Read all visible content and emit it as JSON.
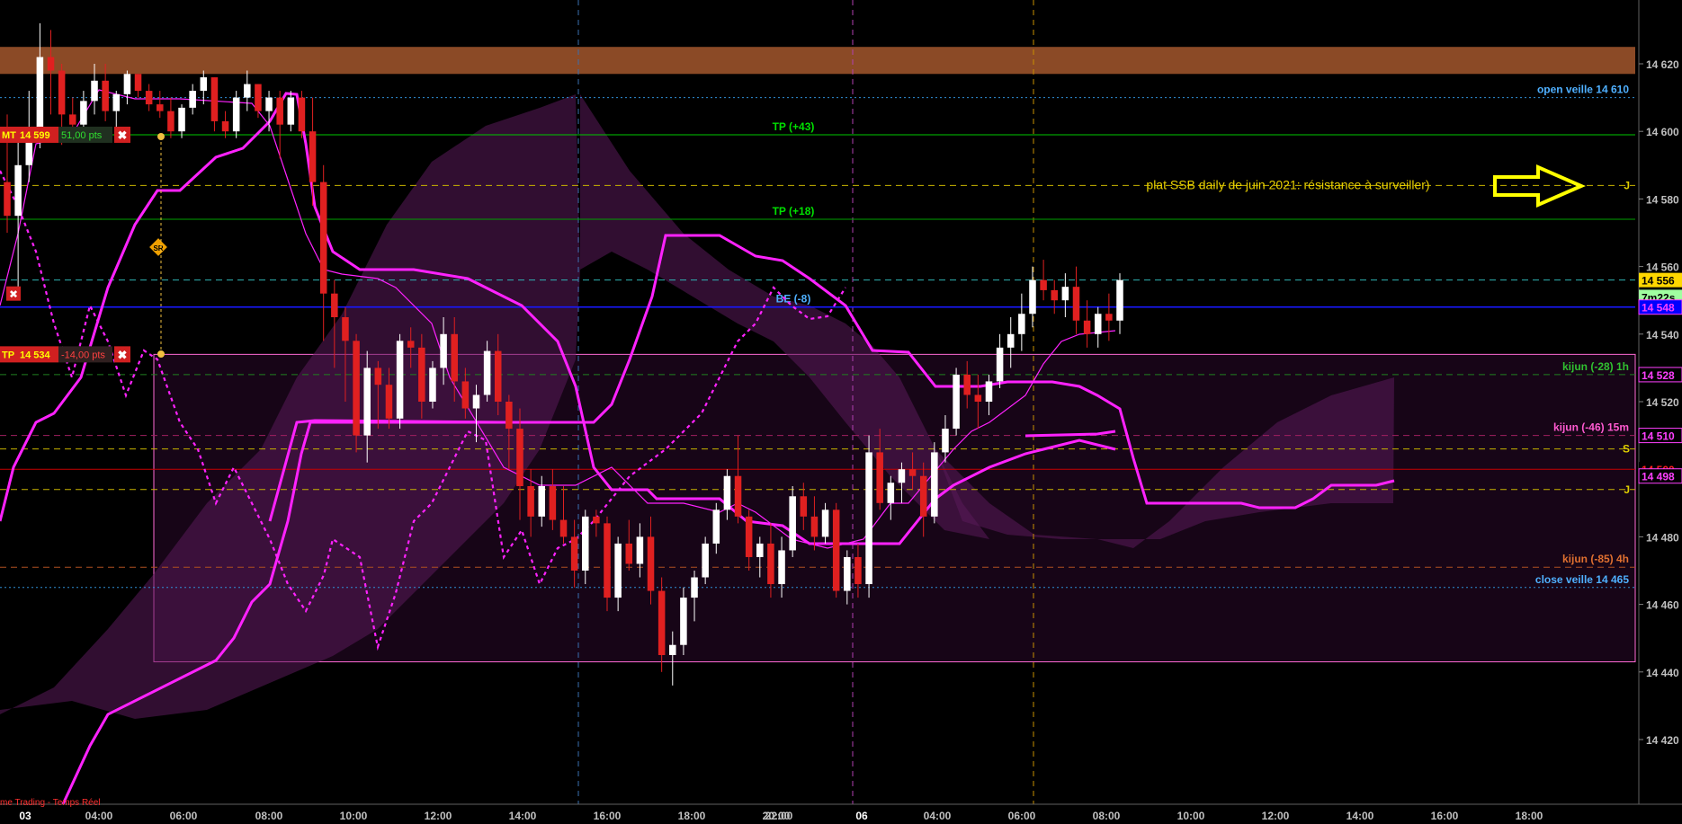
{
  "chart_data": {
    "type": "candlestick",
    "title": "",
    "footer": "me Trading - Temps Réel",
    "yaxis": {
      "ylim": [
        14408,
        14633
      ],
      "ticks": [
        "14 620",
        "14 600",
        "14 580",
        "14 560",
        "14 540",
        "14 520",
        "14 500",
        "14 480",
        "14 460",
        "14 440",
        "14 420"
      ]
    },
    "xaxis": {
      "labels": [
        "03",
        "04:00",
        "06:00",
        "08:00",
        "10:00",
        "12:00",
        "14:00",
        "16:00",
        "18:00",
        "20:00",
        "22:00",
        "06",
        "04:00",
        "06:00",
        "08:00",
        "10:00",
        "12:00",
        "14:00",
        "16:00",
        "18:00"
      ],
      "bold_labels": [
        "03",
        "06"
      ]
    },
    "candles_ohlc": [
      [
        14585,
        14605,
        14570,
        14575
      ],
      [
        14575,
        14598,
        14550,
        14590
      ],
      [
        14590,
        14612,
        14585,
        14598
      ],
      [
        14598,
        14632,
        14595,
        14622
      ],
      [
        14622,
        14630,
        14605,
        14618
      ],
      [
        14618,
        14620,
        14596,
        14605
      ],
      [
        14605,
        14610,
        14598,
        14602
      ],
      [
        14602,
        14612,
        14600,
        14609
      ],
      [
        14609,
        14620,
        14605,
        14615
      ],
      [
        14615,
        14620,
        14603,
        14606
      ],
      [
        14606,
        14612,
        14600,
        14611
      ],
      [
        14611,
        14618,
        14608,
        14617
      ],
      [
        14617,
        14617,
        14610,
        14612
      ],
      [
        14612,
        14614,
        14606,
        14608
      ],
      [
        14608,
        14612,
        14604,
        14606
      ],
      [
        14606,
        14610,
        14598,
        14600
      ],
      [
        14600,
        14608,
        14598,
        14607
      ],
      [
        14607,
        14614,
        14605,
        14612
      ],
      [
        14612,
        14618,
        14608,
        14616
      ],
      [
        14616,
        14616,
        14600,
        14603
      ],
      [
        14603,
        14606,
        14598,
        14600
      ],
      [
        14600,
        14612,
        14598,
        14610
      ],
      [
        14610,
        14618,
        14606,
        14614
      ],
      [
        14614,
        14614,
        14604,
        14606
      ],
      [
        14606,
        14612,
        14600,
        14610
      ],
      [
        14610,
        14612,
        14592,
        14602
      ],
      [
        14602,
        14612,
        14600,
        14610
      ],
      [
        14610,
        14612,
        14598,
        14600
      ],
      [
        14600,
        14610,
        14578,
        14585
      ],
      [
        14585,
        14590,
        14538,
        14552
      ],
      [
        14552,
        14556,
        14530,
        14545
      ],
      [
        14545,
        14548,
        14520,
        14538
      ],
      [
        14538,
        14540,
        14505,
        14510
      ],
      [
        14510,
        14535,
        14502,
        14530
      ],
      [
        14530,
        14532,
        14512,
        14525
      ],
      [
        14525,
        14530,
        14512,
        14515
      ],
      [
        14515,
        14540,
        14512,
        14538
      ],
      [
        14538,
        14542,
        14530,
        14536
      ],
      [
        14536,
        14540,
        14515,
        14520
      ],
      [
        14520,
        14532,
        14518,
        14530
      ],
      [
        14530,
        14545,
        14525,
        14540
      ],
      [
        14540,
        14545,
        14520,
        14526
      ],
      [
        14526,
        14530,
        14515,
        14518
      ],
      [
        14518,
        14525,
        14508,
        14522
      ],
      [
        14522,
        14538,
        14520,
        14535
      ],
      [
        14535,
        14540,
        14516,
        14520
      ],
      [
        14520,
        14522,
        14500,
        14512
      ],
      [
        14512,
        14518,
        14485,
        14495
      ],
      [
        14495,
        14500,
        14480,
        14486
      ],
      [
        14486,
        14498,
        14483,
        14495
      ],
      [
        14495,
        14500,
        14482,
        14485
      ],
      [
        14485,
        14495,
        14478,
        14480
      ],
      [
        14480,
        14485,
        14465,
        14470
      ],
      [
        14470,
        14488,
        14466,
        14486
      ],
      [
        14486,
        14488,
        14480,
        14484
      ],
      [
        14484,
        14486,
        14458,
        14462
      ],
      [
        14462,
        14480,
        14458,
        14478
      ],
      [
        14478,
        14485,
        14470,
        14472
      ],
      [
        14472,
        14484,
        14468,
        14480
      ],
      [
        14480,
        14486,
        14460,
        14464
      ],
      [
        14464,
        14468,
        14440,
        14445
      ],
      [
        14445,
        14452,
        14436,
        14448
      ],
      [
        14448,
        14465,
        14445,
        14462
      ],
      [
        14462,
        14470,
        14455,
        14468
      ],
      [
        14468,
        14480,
        14466,
        14478
      ],
      [
        14478,
        14490,
        14475,
        14488
      ],
      [
        14488,
        14500,
        14485,
        14498
      ],
      [
        14498,
        14510,
        14484,
        14486
      ],
      [
        14486,
        14488,
        14470,
        14474
      ],
      [
        14474,
        14480,
        14468,
        14478
      ],
      [
        14478,
        14484,
        14462,
        14466
      ],
      [
        14466,
        14480,
        14462,
        14476
      ],
      [
        14476,
        14495,
        14474,
        14492
      ],
      [
        14492,
        14496,
        14482,
        14486
      ],
      [
        14486,
        14492,
        14476,
        14480
      ],
      [
        14480,
        14490,
        14478,
        14488
      ],
      [
        14488,
        14490,
        14462,
        14464
      ],
      [
        14464,
        14476,
        14460,
        14474
      ],
      [
        14474,
        14478,
        14462,
        14466
      ],
      [
        14466,
        14510,
        14462,
        14505
      ],
      [
        14505,
        14512,
        14488,
        14490
      ],
      [
        14490,
        14498,
        14485,
        14496
      ],
      [
        14496,
        14502,
        14490,
        14500
      ],
      [
        14500,
        14505,
        14494,
        14498
      ],
      [
        14498,
        14502,
        14480,
        14486
      ],
      [
        14486,
        14508,
        14484,
        14505
      ],
      [
        14505,
        14516,
        14502,
        14512
      ],
      [
        14512,
        14530,
        14510,
        14528
      ],
      [
        14528,
        14532,
        14518,
        14522
      ],
      [
        14522,
        14528,
        14512,
        14520
      ],
      [
        14520,
        14528,
        14516,
        14526
      ],
      [
        14526,
        14540,
        14524,
        14536
      ],
      [
        14536,
        14545,
        14530,
        14540
      ],
      [
        14540,
        14552,
        14535,
        14546
      ],
      [
        14546,
        14560,
        14542,
        14556
      ],
      [
        14556,
        14562,
        14550,
        14553
      ],
      [
        14553,
        14556,
        14546,
        14550
      ],
      [
        14550,
        14558,
        14545,
        14554
      ],
      [
        14554,
        14560,
        14540,
        14544
      ],
      [
        14544,
        14550,
        14536,
        14540
      ],
      [
        14540,
        14548,
        14536,
        14546
      ],
      [
        14546,
        14552,
        14538,
        14544
      ],
      [
        14544,
        14558,
        14540,
        14556
      ]
    ],
    "levels": [
      {
        "label": "open veille 14 610",
        "value": 14610,
        "color": "#2f8fd6",
        "style": "dotted"
      },
      {
        "label": "TP (+43)",
        "value": 14599,
        "color": "#00c800",
        "style": "solid"
      },
      {
        "label": "plat SSB daily de juin 2021: résistance à surveiller)",
        "value": 14584,
        "color": "#c8b400",
        "style": "dashed",
        "tag": "J"
      },
      {
        "label": "TP (+18)",
        "value": 14574,
        "color": "#00a000",
        "style": "solid"
      },
      {
        "label": "",
        "value": 14556,
        "color": "#2fb4b4",
        "style": "dashed"
      },
      {
        "label": "BE (-8)",
        "value": 14548,
        "color": "#b4b4b4",
        "style": "solid"
      },
      {
        "label": "",
        "value": 14548,
        "color": "#1818ff",
        "style": "solid"
      },
      {
        "label": "kijun (-28) 1h",
        "value": 14528,
        "color": "#208020",
        "style": "dashed"
      },
      {
        "label": "kijun (-46) 15m",
        "value": 14510,
        "color": "#a02060",
        "style": "dashed"
      },
      {
        "label": "",
        "value": 14506,
        "color": "#c8b400",
        "style": "dashed",
        "tag": "S"
      },
      {
        "label": "",
        "value": 14500,
        "color": "#c80000",
        "style": "solid"
      },
      {
        "label": "",
        "value": 14494,
        "color": "#c8b400",
        "style": "dashed",
        "tag": "J"
      },
      {
        "label": "kijun (-85) 4h",
        "value": 14471,
        "color": "#b05020",
        "style": "dashed"
      },
      {
        "label": "close veille 14 465",
        "value": 14465,
        "color": "#2f8fd6",
        "style": "dotted"
      }
    ],
    "resistance_zone": {
      "from": 14617,
      "to": 14625,
      "color": "#8b4a26"
    },
    "price_tags": [
      {
        "text": "14 556",
        "value": 14556,
        "bg": "#ffd700",
        "fg": "#000000"
      },
      {
        "text": "7m22s",
        "value": 14551,
        "bg": "#a0ffa0",
        "fg": "#000000"
      },
      {
        "text": "14 548",
        "value": 14548,
        "bg": "#0000ff",
        "fg": "#ff40ff"
      },
      {
        "text": "14 528",
        "value": 14528,
        "bg": "#000000",
        "fg": "#ff40ff"
      },
      {
        "text": "14 510",
        "value": 14510,
        "bg": "#000000",
        "fg": "#ff40ff"
      },
      {
        "text": "14 500",
        "value": 14500,
        "bg": "#000000",
        "fg": "#ff2020"
      },
      {
        "text": "14 498",
        "value": 14498,
        "bg": "#000000",
        "fg": "#ff40ff"
      }
    ],
    "orders": [
      {
        "side": "MT",
        "price": "14 599",
        "pts": "51,00 pts",
        "value": 14599
      },
      {
        "side": "TP",
        "price": "14 534",
        "pts": "-14,00 pts",
        "value": 14534
      }
    ],
    "annotation": "plat SSB daily de juin 2021: résistance à surveiller)",
    "legend_tags": {
      "sr": "SR"
    }
  },
  "colors": {
    "up": "#ffffff",
    "down": "#e02020",
    "kijun": "#ff22ff",
    "cloud": "#3a0e3a",
    "accent": "#ffff00"
  }
}
